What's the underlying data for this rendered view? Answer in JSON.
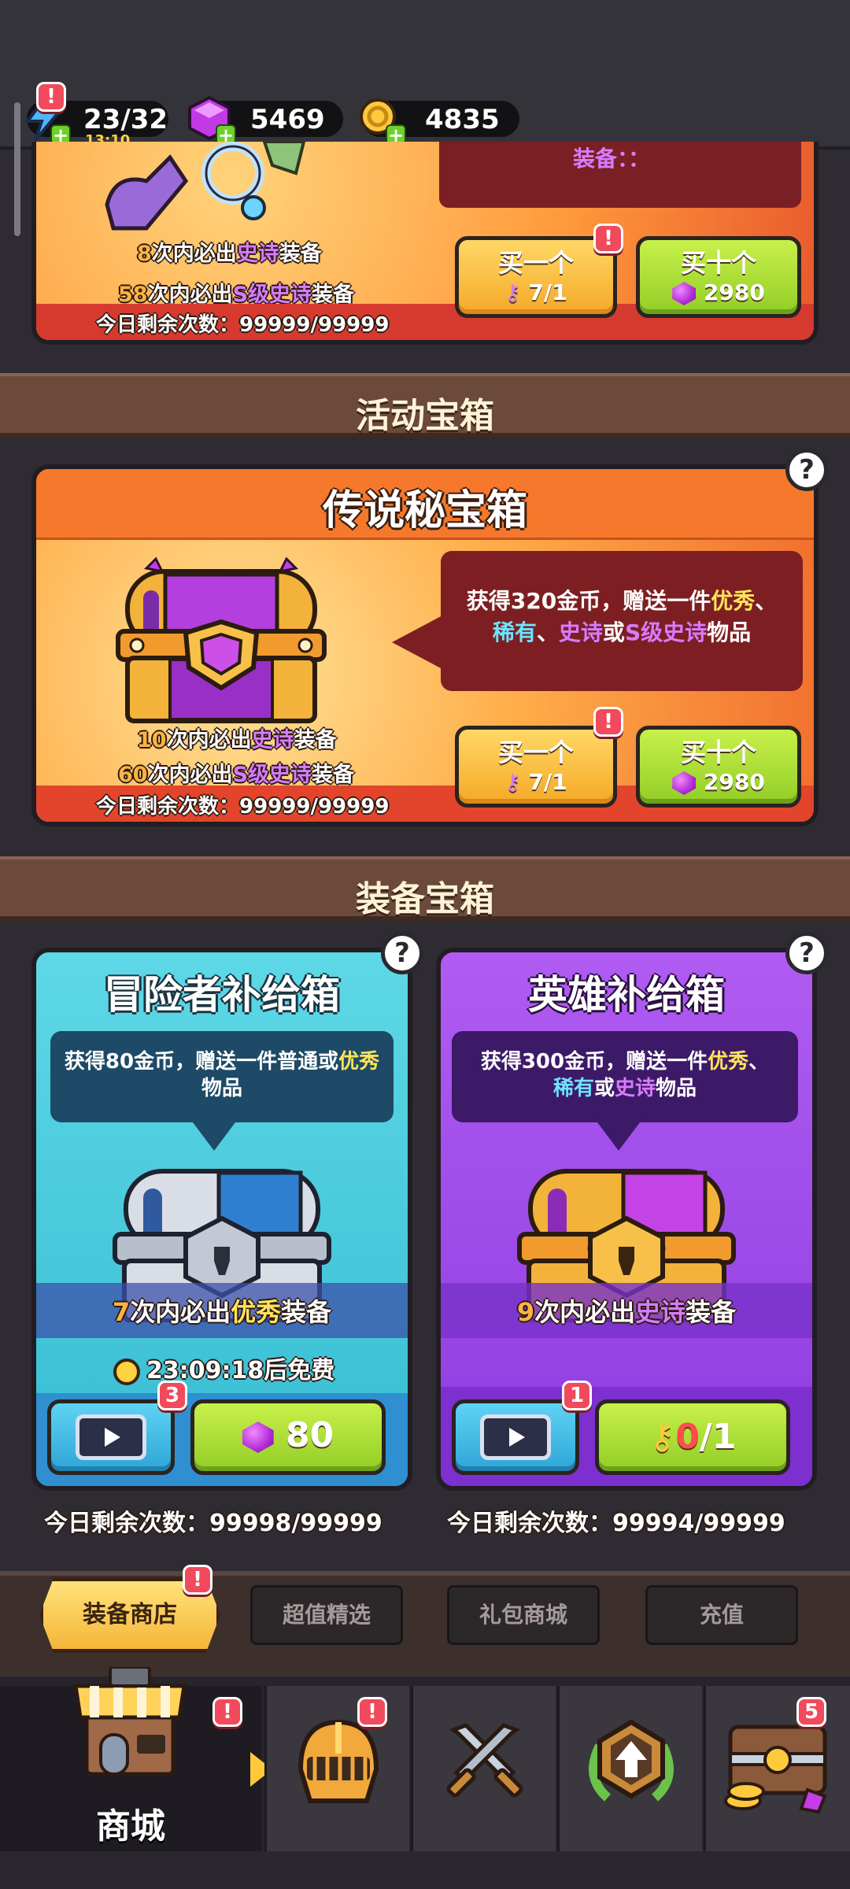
{
  "resources": {
    "energy": "23/32",
    "energy_timer": "13:10",
    "gems": "5469",
    "coins": "4835"
  },
  "top_card": {
    "preview_text": "装备：：",
    "pity_1_num": "8",
    "pity_1_text": "次内必出",
    "pity_1_tier": "史诗",
    "pity_1_suffix": "装备",
    "pity_2_num": "58",
    "pity_2_text": "次内必出",
    "pity_2_tier": "S级史诗",
    "pity_2_suffix": "装备",
    "remaining_label": "今日剩余次数：",
    "remaining_value": "99999/99999",
    "buy_one_label": "买一个",
    "buy_one_cost": "7/1",
    "buy_ten_label": "买十个",
    "buy_ten_cost": "2980"
  },
  "event_section": {
    "title": "活动宝箱"
  },
  "legend_chest": {
    "title": "传说秘宝箱",
    "desc_1": "获得320金币，赠送一件",
    "desc_tier_1": "优秀",
    "desc_sep_1": "、",
    "desc_tier_2": "稀有",
    "desc_sep_2": "、",
    "desc_tier_3": "史诗",
    "desc_or": "或",
    "desc_tier_4": "S级史诗",
    "desc_end": "物品",
    "pity_1_num": "10",
    "pity_1_text": "次内必出",
    "pity_1_tier": "史诗",
    "pity_1_suffix": "装备",
    "pity_2_num": "60",
    "pity_2_text": "次内必出",
    "pity_2_tier": "S级史诗",
    "pity_2_suffix": "装备",
    "remaining_label": "今日剩余次数：",
    "remaining_value": "99999/99999",
    "buy_one_label": "买一个",
    "buy_one_cost": "7/1",
    "buy_ten_label": "买十个",
    "buy_ten_cost": "2980"
  },
  "equipment_section": {
    "title": "装备宝箱"
  },
  "adventurer_chest": {
    "title": "冒险者补给箱",
    "desc_1": "获得80金币，赠送一件普通或",
    "desc_tier": "优秀",
    "desc_end": "物品",
    "pity_num": "7",
    "pity_text": "次内必出",
    "pity_tier": "优秀",
    "pity_suffix": "装备",
    "timer": "23:09:18后免费",
    "video_badge": "3",
    "price": "80",
    "remaining_label": "今日剩余次数：",
    "remaining_value": "99998/99999"
  },
  "hero_chest": {
    "title": "英雄补给箱",
    "desc_1": "获得300金币，赠送一件",
    "desc_tier_1": "优秀",
    "desc_sep": "、",
    "desc_tier_2": "稀有",
    "desc_or": "或",
    "desc_tier_3": "史诗",
    "desc_end": "物品",
    "pity_num": "9",
    "pity_text": "次内必出",
    "pity_tier": "史诗",
    "pity_suffix": "装备",
    "video_badge": "1",
    "key_have": "0",
    "key_total": "/1",
    "remaining_label": "今日剩余次数：",
    "remaining_value": "99994/99999"
  },
  "shop_tabs": [
    "装备商店",
    "超值精选",
    "礼包商城",
    "充值"
  ],
  "bottom_nav": {
    "shop_label": "商城",
    "chest_badge": "5"
  },
  "alert_mark": "!",
  "help_mark": "?",
  "colors": {
    "epic": "#d77bff",
    "excellent": "#ffe45a",
    "rare": "#6ee3ff",
    "pity_number": "#ffb341",
    "alert": "#f04a5c"
  }
}
